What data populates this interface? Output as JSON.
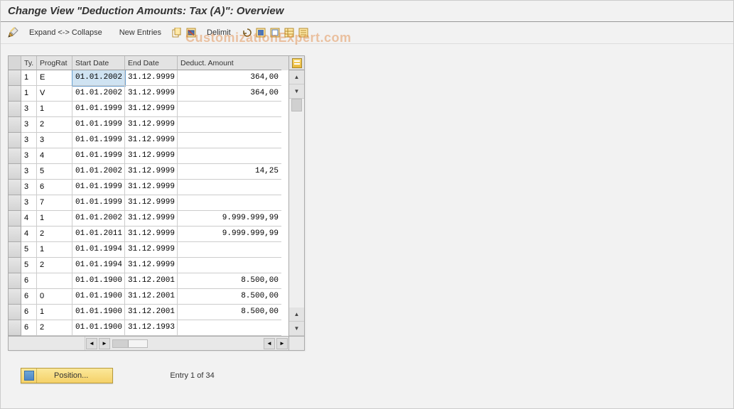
{
  "header": {
    "title": "Change View \"Deduction Amounts: Tax (A)\": Overview"
  },
  "toolbar": {
    "expand_collapse": "Expand <-> Collapse",
    "new_entries": "New Entries",
    "delimit": "Delimit"
  },
  "watermark": "CustomizationExpert.com",
  "grid": {
    "columns": {
      "ty": "Ty.",
      "prograt": "ProgRat",
      "start_date": "Start Date",
      "end_date": "End Date",
      "deduct_amount": "Deduct. Amount"
    },
    "rows": [
      {
        "ty": "1",
        "pr": "E",
        "sd": "01.01.2002",
        "ed": "31.12.9999",
        "da": "364,00",
        "sel": true
      },
      {
        "ty": "1",
        "pr": "V",
        "sd": "01.01.2002",
        "ed": "31.12.9999",
        "da": "364,00"
      },
      {
        "ty": "3",
        "pr": "1",
        "sd": "01.01.1999",
        "ed": "31.12.9999",
        "da": ""
      },
      {
        "ty": "3",
        "pr": "2",
        "sd": "01.01.1999",
        "ed": "31.12.9999",
        "da": ""
      },
      {
        "ty": "3",
        "pr": "3",
        "sd": "01.01.1999",
        "ed": "31.12.9999",
        "da": ""
      },
      {
        "ty": "3",
        "pr": "4",
        "sd": "01.01.1999",
        "ed": "31.12.9999",
        "da": ""
      },
      {
        "ty": "3",
        "pr": "5",
        "sd": "01.01.2002",
        "ed": "31.12.9999",
        "da": "14,25"
      },
      {
        "ty": "3",
        "pr": "6",
        "sd": "01.01.1999",
        "ed": "31.12.9999",
        "da": ""
      },
      {
        "ty": "3",
        "pr": "7",
        "sd": "01.01.1999",
        "ed": "31.12.9999",
        "da": ""
      },
      {
        "ty": "4",
        "pr": "1",
        "sd": "01.01.2002",
        "ed": "31.12.9999",
        "da": "9.999.999,99"
      },
      {
        "ty": "4",
        "pr": "2",
        "sd": "01.01.2011",
        "ed": "31.12.9999",
        "da": "9.999.999,99"
      },
      {
        "ty": "5",
        "pr": "1",
        "sd": "01.01.1994",
        "ed": "31.12.9999",
        "da": ""
      },
      {
        "ty": "5",
        "pr": "2",
        "sd": "01.01.1994",
        "ed": "31.12.9999",
        "da": ""
      },
      {
        "ty": "6",
        "pr": "",
        "sd": "01.01.1900",
        "ed": "31.12.2001",
        "da": "8.500,00"
      },
      {
        "ty": "6",
        "pr": "0",
        "sd": "01.01.1900",
        "ed": "31.12.2001",
        "da": "8.500,00"
      },
      {
        "ty": "6",
        "pr": "1",
        "sd": "01.01.1900",
        "ed": "31.12.2001",
        "da": "8.500,00"
      },
      {
        "ty": "6",
        "pr": "2",
        "sd": "01.01.1900",
        "ed": "31.12.1993",
        "da": ""
      }
    ]
  },
  "footer": {
    "position_label": "Position...",
    "entry_text": "Entry 1 of 34"
  }
}
